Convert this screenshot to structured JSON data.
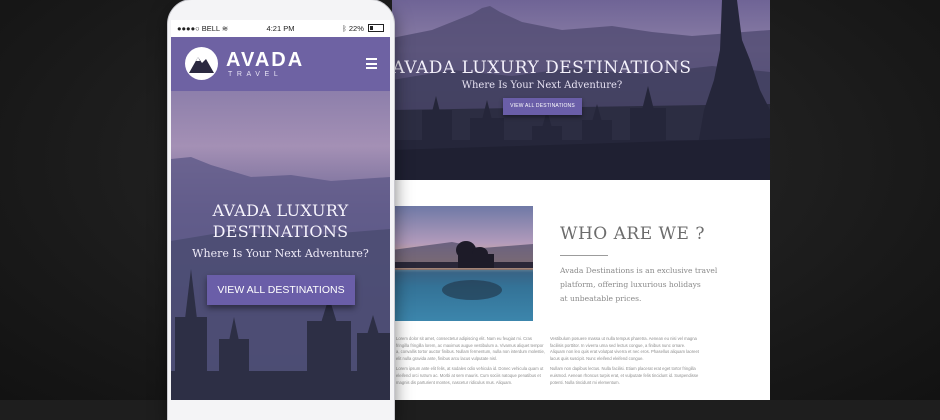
{
  "colors": {
    "accent": "#6e62a3",
    "button": "#6a5ea8",
    "page_bg": "#1e1e1e"
  },
  "phone": {
    "status_bar": {
      "carrier": "BELL",
      "time": "4:21 PM",
      "battery": "22%",
      "icons": [
        "signal-icon",
        "wifi-icon",
        "bluetooth-icon",
        "battery-icon"
      ]
    },
    "brand": {
      "name": "AVADA",
      "tagline": "TRAVEL",
      "logo_icon": "mountain-logo-icon"
    },
    "menu_icon": "hamburger-menu-icon",
    "hero": {
      "title_line1": "AVADA LUXURY",
      "title_line2": "DESTINATIONS",
      "subtitle": "Where Is Your Next Adventure?",
      "button": "VIEW ALL DESTINATIONS"
    }
  },
  "desktop": {
    "hero": {
      "title": "AVADA LUXURY DESTINATIONS",
      "subtitle": "Where Is Your Next Adventure?",
      "button": "VIEW ALL DESTINATIONS"
    },
    "about": {
      "heading": "WHO ARE WE ?",
      "text_line1": "Avada Destinations is an exclusive travel",
      "text_line2": "platform, offering luxurious holidays",
      "text_line3": "at unbeatable prices."
    },
    "columns": [
      {
        "p1": "Lorem dolor sit amet, consectetur adipiscing elit. Nam eu feugiat mi. Cras fringilla fringilla lorem, ac maximus augue vestibulum a. Vivamus aliquet tempor a, convallis tortor auctor finibus. Nullam fermentum, nulla non interdum molestie, elit nulla gravida ante, finibus arcu lacus vulputate nisl.",
        "p2": "Lorem ipsum ante elit felis, at sodales odio vehicula id. Donec vehicula quam ut eleifend orci rutrum ac. Morbi at sem mauris. Cum sociis natoque penatibus et magnis dis parturient montes, nascetur ridiculus mus. Aliquam."
      },
      {
        "p1": "Vestibulum posuere massa ut nulla tempus pharetra. Aenean eu nisi vel magna facilisis porttitor. In viverra urna sed lectus congue, a finibus nunc ornare. Aliquam non leo quis erat volutpat viverra et nec eros. Phasellus aliquam laoreet lacus quis suscipit. Nunc eleifend eleifend congue.",
        "p2": "Nullam non dapibus lectus. Nulla facilisi. Etiam placerat erat eget tortor fringilla euismod. Aenean rhoncus turpis erat, et vulputate felis tincidunt id. Suspendisse potenti. Nulla tincidunt mi elementum."
      }
    ]
  }
}
